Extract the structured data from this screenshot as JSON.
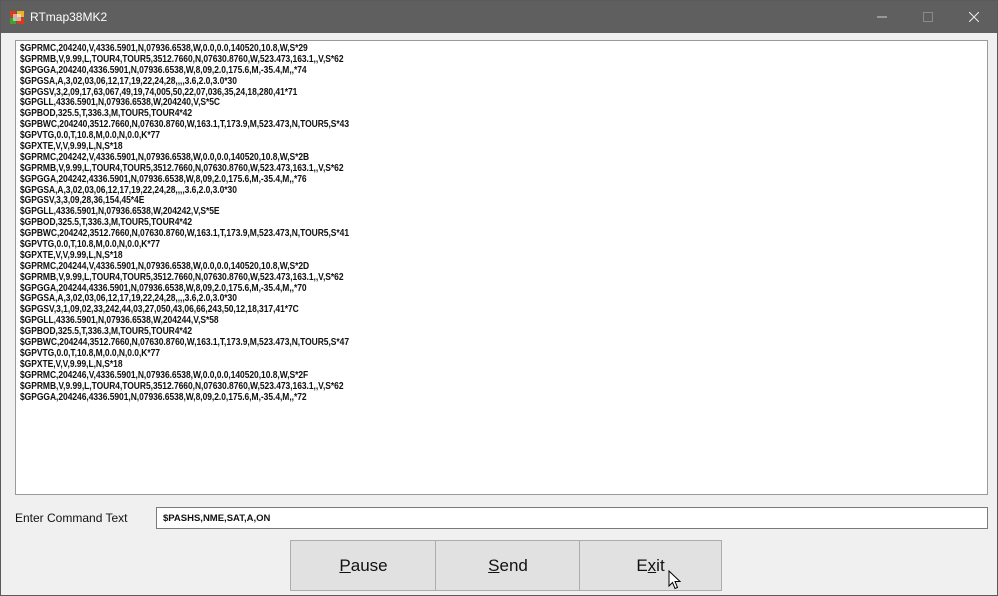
{
  "window": {
    "title": "RTmap38MK2",
    "controls": [
      "minimize",
      "maximize",
      "close"
    ]
  },
  "output_lines": [
    "$GPRMC,204240,V,4336.5901,N,07936.6538,W,0.0,0.0,140520,10.8,W,S*29",
    "$GPRMB,V,9.99,L,TOUR4,TOUR5,3512.7660,N,07630.8760,W,523.473,163.1,,V,S*62",
    "$GPGGA,204240,4336.5901,N,07936.6538,W,8,09,2.0,175.6,M,-35.4,M,,*74",
    "$GPGSA,A,3,02,03,06,12,17,19,22,24,28,,,,3.6,2.0,3.0*30",
    "$GPGSV,3,2,09,17,63,067,49,19,74,005,50,22,07,036,35,24,18,280,41*71",
    "$GPGLL,4336.5901,N,07936.6538,W,204240,V,S*5C",
    "$GPBOD,325.5,T,336.3,M,TOUR5,TOUR4*42",
    "$GPBWC,204240,3512.7660,N,07630.8760,W,163.1,T,173.9,M,523.473,N,TOUR5,S*43",
    "$GPVTG,0.0,T,10.8,M,0.0,N,0.0,K*77",
    "$GPXTE,V,V,9.99,L,N,S*18",
    "$GPRMC,204242,V,4336.5901,N,07936.6538,W,0.0,0.0,140520,10.8,W,S*2B",
    "$GPRMB,V,9.99,L,TOUR4,TOUR5,3512.7660,N,07630.8760,W,523.473,163.1,,V,S*62",
    "$GPGGA,204242,4336.5901,N,07936.6538,W,8,09,2.0,175.6,M,-35.4,M,,*76",
    "$GPGSA,A,3,02,03,06,12,17,19,22,24,28,,,,3.6,2.0,3.0*30",
    "$GPGSV,3,3,09,28,36,154,45*4E",
    "$GPGLL,4336.5901,N,07936.6538,W,204242,V,S*5E",
    "$GPBOD,325.5,T,336.3,M,TOUR5,TOUR4*42",
    "$GPBWC,204242,3512.7660,N,07630.8760,W,163.1,T,173.9,M,523.473,N,TOUR5,S*41",
    "$GPVTG,0.0,T,10.8,M,0.0,N,0.0,K*77",
    "$GPXTE,V,V,9.99,L,N,S*18",
    "$GPRMC,204244,V,4336.5901,N,07936.6538,W,0.0,0.0,140520,10.8,W,S*2D",
    "$GPRMB,V,9.99,L,TOUR4,TOUR5,3512.7660,N,07630.8760,W,523.473,163.1,,V,S*62",
    "$GPGGA,204244,4336.5901,N,07936.6538,W,8,09,2.0,175.6,M,-35.4,M,,*70",
    "$GPGSA,A,3,02,03,06,12,17,19,22,24,28,,,,3.6,2.0,3.0*30",
    "$GPGSV,3,1,09,02,33,242,44,03,27,050,43,06,66,243,50,12,18,317,41*7C",
    "$GPGLL,4336.5901,N,07936.6538,W,204244,V,S*58",
    "$GPBOD,325.5,T,336.3,M,TOUR5,TOUR4*42",
    "$GPBWC,204244,3512.7660,N,07630.8760,W,163.1,T,173.9,M,523.473,N,TOUR5,S*47",
    "$GPVTG,0.0,T,10.8,M,0.0,N,0.0,K*77",
    "$GPXTE,V,V,9.99,L,N,S*18",
    "$GPRMC,204246,V,4336.5901,N,07936.6538,W,0.0,0.0,140520,10.8,W,S*2F",
    "$GPRMB,V,9.99,L,TOUR4,TOUR5,3512.7660,N,07630.8760,W,523.473,163.1,,V,S*62",
    "$GPGGA,204246,4336.5901,N,07936.6538,W,8,09,2.0,175.6,M,-35.4,M,,*72"
  ],
  "command": {
    "label": "Enter Command Text",
    "value": "$PASHS,NME,SAT,A,ON"
  },
  "buttons": {
    "pause": {
      "label": "Pause",
      "mnemonic": "P"
    },
    "send": {
      "label": "Send",
      "mnemonic": "S"
    },
    "exit": {
      "label": "Exit",
      "mnemonic": "x"
    }
  },
  "icons": {
    "app": "app-icon",
    "minimize": "minimize-icon",
    "maximize": "maximize-icon",
    "close": "close-icon",
    "cursor": "mouse-pointer-icon"
  },
  "colors": {
    "titlebar": "#5f5f5f",
    "window_bg": "#f0f0f0",
    "button_bg": "#e1e1e1",
    "text": "#111111"
  }
}
